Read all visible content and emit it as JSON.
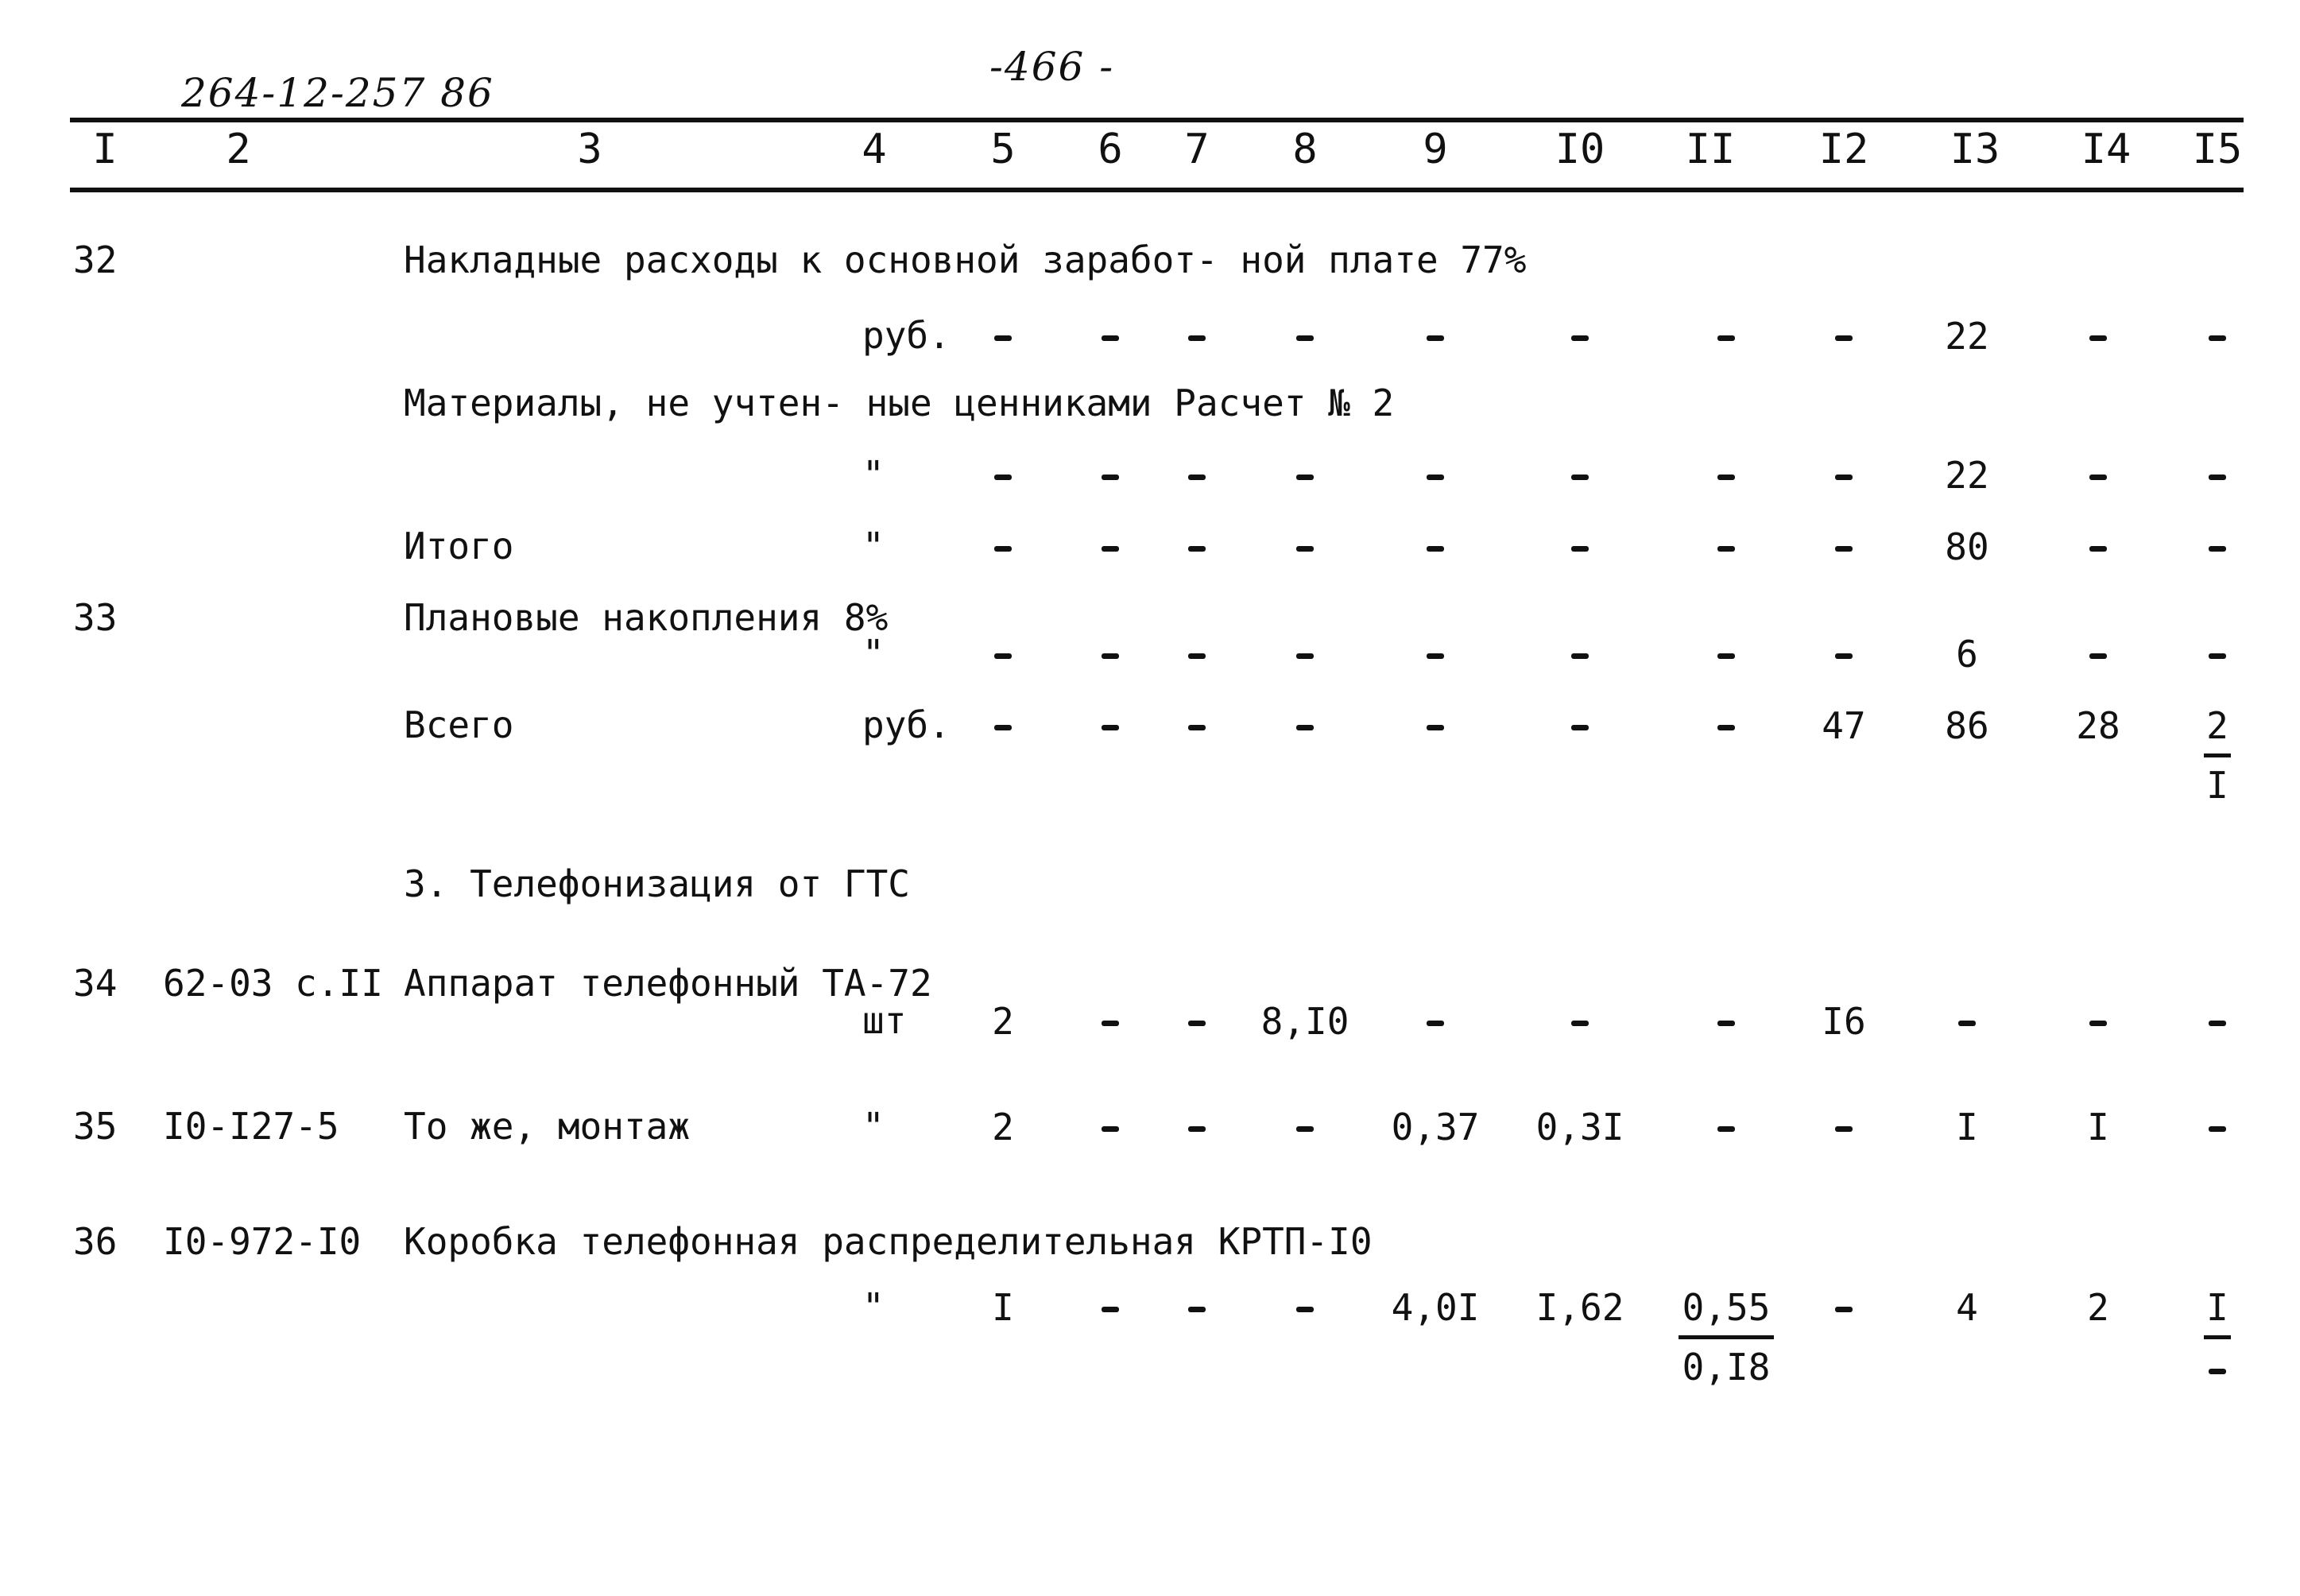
{
  "doc_code": "264-12-257 86",
  "page_number": "-466 -",
  "columns": [
    "I",
    "2",
    "3",
    "4",
    "5",
    "6",
    "7",
    "8",
    "9",
    "I0",
    "II",
    "I2",
    "I3",
    "I4",
    "I5"
  ],
  "rows": [
    {
      "no": "32",
      "code": "",
      "name": "Накладные расходы\nк основной заработ-\nной плате 77%",
      "unit": "руб.",
      "values": [
        "-",
        "-",
        "-",
        "-",
        "-",
        "-",
        "-",
        "-",
        "22",
        "-",
        "-"
      ]
    },
    {
      "no": "",
      "code": "",
      "name": "Материалы, не учтен-\nные ценниками\nРасчет № 2",
      "unit": "\"",
      "values": [
        "-",
        "-",
        "-",
        "-",
        "-",
        "-",
        "-",
        "-",
        "22",
        "-",
        "-"
      ]
    },
    {
      "no": "",
      "code": "",
      "name": "Итого",
      "unit": "\"",
      "values": [
        "-",
        "-",
        "-",
        "-",
        "-",
        "-",
        "-",
        "-",
        "80",
        "-",
        "-"
      ]
    },
    {
      "no": "33",
      "code": "",
      "name": "Плановые\nнакопления 8%",
      "unit": "\"",
      "values": [
        "-",
        "-",
        "-",
        "-",
        "-",
        "-",
        "-",
        "-",
        "6",
        "-",
        "-"
      ]
    },
    {
      "no": "",
      "code": "",
      "name": "Всего",
      "unit": "руб.",
      "values": [
        "-",
        "-",
        "-",
        "-",
        "-",
        "-",
        "-",
        "47",
        "86",
        "28",
        "2"
      ],
      "sub_values": {
        "15": "I"
      }
    },
    {
      "section": "3. Телефонизация\n   от ГТС"
    },
    {
      "no": "34",
      "code": "62-03\n с.II",
      "name": "Аппарат телефонный\nТА-72",
      "unit": "шт",
      "values": [
        "2",
        "-",
        "-",
        "8,I0",
        "-",
        "-",
        "-",
        "I6",
        "-",
        "-",
        "-"
      ]
    },
    {
      "no": "35",
      "code": "I0-I27-5",
      "name": "То же, монтаж",
      "unit": "\"",
      "values": [
        "2",
        "-",
        "-",
        "-",
        "0,37",
        "0,3I",
        "-",
        "-",
        "I",
        "I",
        "-"
      ]
    },
    {
      "no": "36",
      "code": "I0-972-I0",
      "name": "Коробка телефонная\nраспределительная\nКРТП-I0",
      "unit": "\"",
      "values": [
        "I",
        "-",
        "-",
        "-",
        "4,0I",
        "I,62",
        "0,55",
        "-",
        "4",
        "2",
        "I"
      ],
      "sub_values": {
        "11": "0,I8",
        "15": "-"
      }
    }
  ]
}
